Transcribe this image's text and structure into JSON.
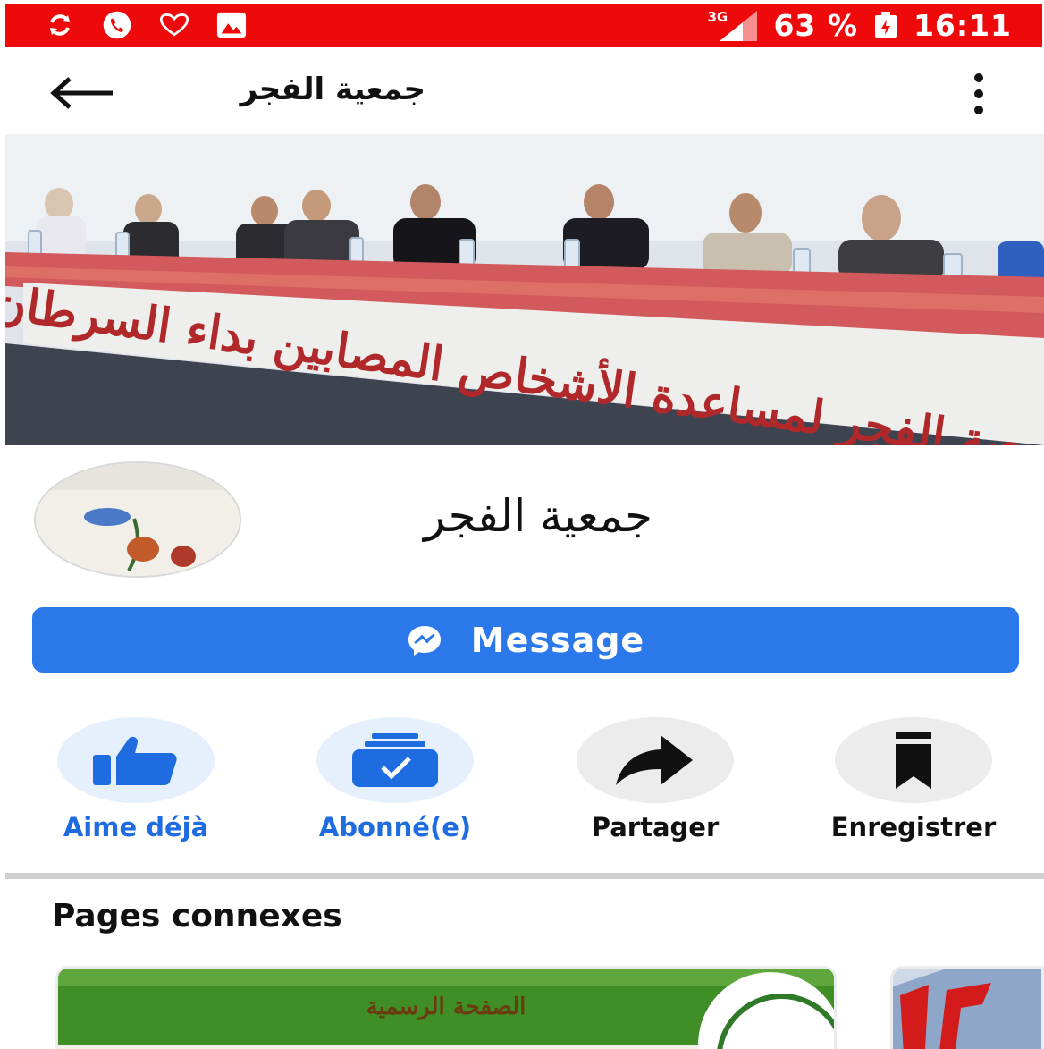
{
  "status_bar": {
    "network": "3G",
    "battery": "63 %",
    "time": "16:11",
    "icons": [
      "sync-icon",
      "phone-icon",
      "heart-icon",
      "gallery-icon",
      "signal-icon",
      "battery-icon"
    ],
    "background_color": "#ee0a0a"
  },
  "app_bar": {
    "title": "جمعية الفجر",
    "back_icon": "arrow-left-icon",
    "more_icon": "more-vertical-icon"
  },
  "cover": {
    "banner_text": "جمعية الفجر لمساعدة الأشخاص المصابين بداء السرطان"
  },
  "profile": {
    "name": "جمعية الفجر"
  },
  "message_button": {
    "label": "Message",
    "icon": "messenger-icon",
    "color": "#2a78ea"
  },
  "actions": [
    {
      "label": "Aime déjà",
      "icon": "thumbs-up-icon",
      "active": true
    },
    {
      "label": "Abonné(e)",
      "icon": "subscribed-icon",
      "active": true
    },
    {
      "label": "Partager",
      "icon": "share-icon",
      "active": false
    },
    {
      "label": "Enregistrer",
      "icon": "bookmark-icon",
      "active": false
    }
  ],
  "related_pages": {
    "title": "Pages connexes",
    "cards": [
      {
        "text": "الصفحة الرسمية"
      },
      {
        "text": ""
      }
    ]
  }
}
